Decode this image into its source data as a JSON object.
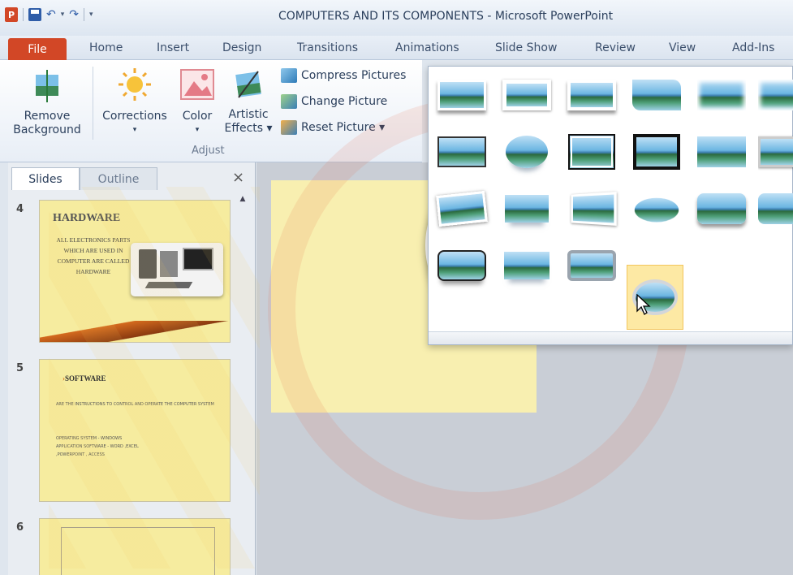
{
  "window": {
    "title": "COMPUTERS AND ITS COMPONENTS - Microsoft PowerPoint",
    "app_logo": "P"
  },
  "tabs": [
    {
      "label": "File"
    },
    {
      "label": "Home"
    },
    {
      "label": "Insert"
    },
    {
      "label": "Design"
    },
    {
      "label": "Transitions"
    },
    {
      "label": "Animations"
    },
    {
      "label": "Slide Show"
    },
    {
      "label": "Review"
    },
    {
      "label": "View"
    },
    {
      "label": "Add-Ins"
    }
  ],
  "ribbon": {
    "remove_background": {
      "line1": "Remove",
      "line2": "Background"
    },
    "corrections": {
      "label": "Corrections",
      "arrow": "▾"
    },
    "color": {
      "label": "Color",
      "arrow": "▾"
    },
    "artistic_effects": {
      "line1": "Artistic",
      "line2": "Effects ▾"
    },
    "compress_pictures": "Compress Pictures",
    "change_picture": "Change Picture",
    "reset_picture": "Reset Picture ▾",
    "group_adjust": "Adjust"
  },
  "panel": {
    "tab_slides": "Slides",
    "tab_outline": "Outline",
    "close": "×",
    "slides": [
      {
        "number": "4",
        "title": "HARDWARE",
        "body": "ALL ELECTRONICS PARTS WHICH ARE USED IN COMPUTER ARE CALLED HARDWARE"
      },
      {
        "number": "5",
        "title": "SOFTWARE",
        "body1": "ARE THE INSTRUCTIONS TO CONTROL AND OPERATE THE COMPUTER SYSTEM",
        "body2": "OPERATING SYSTEM - WINDOWS",
        "body3": "APPLICATION SOFTWARE - WORD ,EXCEL",
        "body4": ",POWERPOINT , ACCESS"
      },
      {
        "number": "6"
      }
    ]
  },
  "gallery": {
    "selected_index": 19
  },
  "colors": {
    "file_tab": "#d24726",
    "slide_background": "#f6ec9f",
    "hover_highlight": "#fde9a4"
  }
}
